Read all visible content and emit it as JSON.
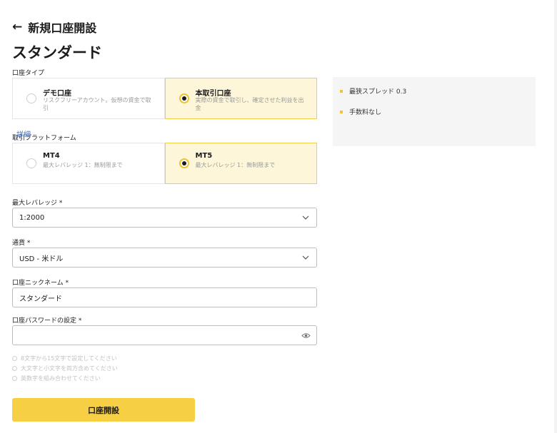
{
  "header": {
    "back_arrow": "←",
    "back_title": "新規口座開設",
    "page_title": "スタンダード"
  },
  "account_type": {
    "label": "口座タイプ",
    "options": [
      {
        "title": "デモ口座",
        "desc": "リスクフリーアカウント。仮想の資金で取引",
        "selected": false
      },
      {
        "title": "本取引口座",
        "desc": "実際の資金で取引し、確定させた利益を出金",
        "selected": true
      }
    ]
  },
  "platform": {
    "label": "取引プラットフォーム",
    "options": [
      {
        "title": "MT4",
        "desc": "最大レバレッジ 1：無制限まで",
        "selected": false
      },
      {
        "title": "MT5",
        "desc": "最大レバレッジ 1：無制限まで",
        "selected": true
      }
    ]
  },
  "side_panel": {
    "features": [
      "最狭スプレッド 0.3",
      "手数料なし"
    ],
    "details_link": "詳細",
    "bullet_color": "#f2c230"
  },
  "form": {
    "leverage": {
      "label": "最大レバレッジ *",
      "value": "1:2000"
    },
    "currency": {
      "label": "通貨 *",
      "value": "USD - 米ドル"
    },
    "nickname": {
      "label": "口座ニックネーム *",
      "value": "スタンダード"
    },
    "password": {
      "label": "口座パスワードの設定 *",
      "value": ""
    },
    "hints": [
      "8文字から15文字で設定してください",
      "大文字と小文字を両方含めてください",
      "英数字を組み合わせてください"
    ]
  },
  "submit_label": "口座開設",
  "colors": {
    "accent": "#f6cf45",
    "selected_bg": "#fdf6d8",
    "selected_border": "#f2cf4a",
    "link": "#3b6fc7"
  }
}
